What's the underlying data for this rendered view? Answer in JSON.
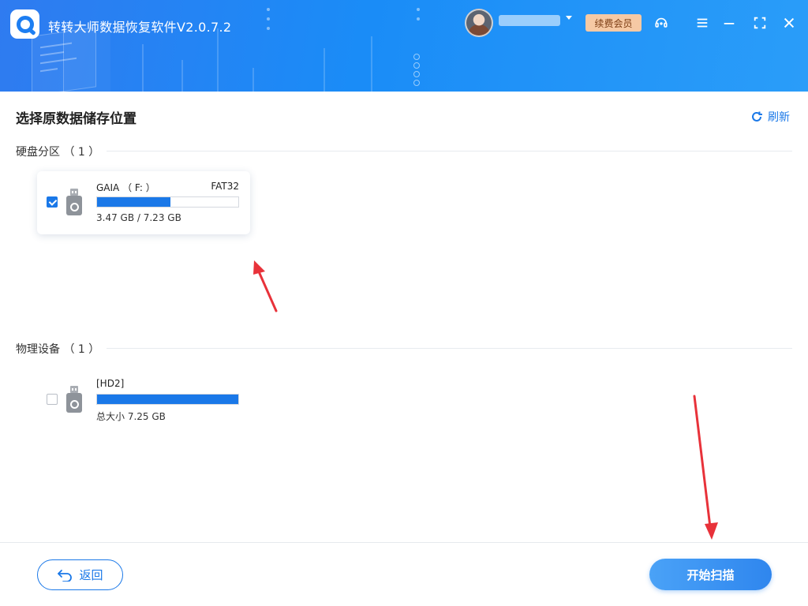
{
  "window": {
    "title": "转转大师数据恢复软件V2.0.7.2",
    "username": "",
    "vip_button": "续费会员"
  },
  "icons": {
    "logo": "app-logo-icon",
    "support": "headset-icon",
    "menu": "menu-icon",
    "minimize": "minimize-icon",
    "maximize": "maximize-icon",
    "close": "close-icon",
    "refresh": "refresh-icon",
    "back": "back-arrow-icon",
    "usb": "usb-drive-icon"
  },
  "main": {
    "title": "选择原数据储存位置",
    "refresh_label": "刷新"
  },
  "partitions": {
    "heading": "硬盘分区 （ 1 ）",
    "items": [
      {
        "name": "GAIA （ F: ）",
        "filesystem": "FAT32",
        "size_text": "3.47 GB / 7.23 GB",
        "used_fraction": 0.52,
        "checked": true
      }
    ]
  },
  "physical": {
    "heading": "物理设备 （ 1 ）",
    "items": [
      {
        "name": "[HD2]",
        "size_text": "总大小 7.25 GB",
        "used_fraction": 1.0,
        "checked": false
      }
    ]
  },
  "footer": {
    "back_label": "返回",
    "scan_label": "开始扫描"
  },
  "colors": {
    "accent": "#1a78e8",
    "titlebar": "#1a8cf7",
    "vip": "#f6c9a4",
    "annotation_arrow": "#e8323a"
  }
}
